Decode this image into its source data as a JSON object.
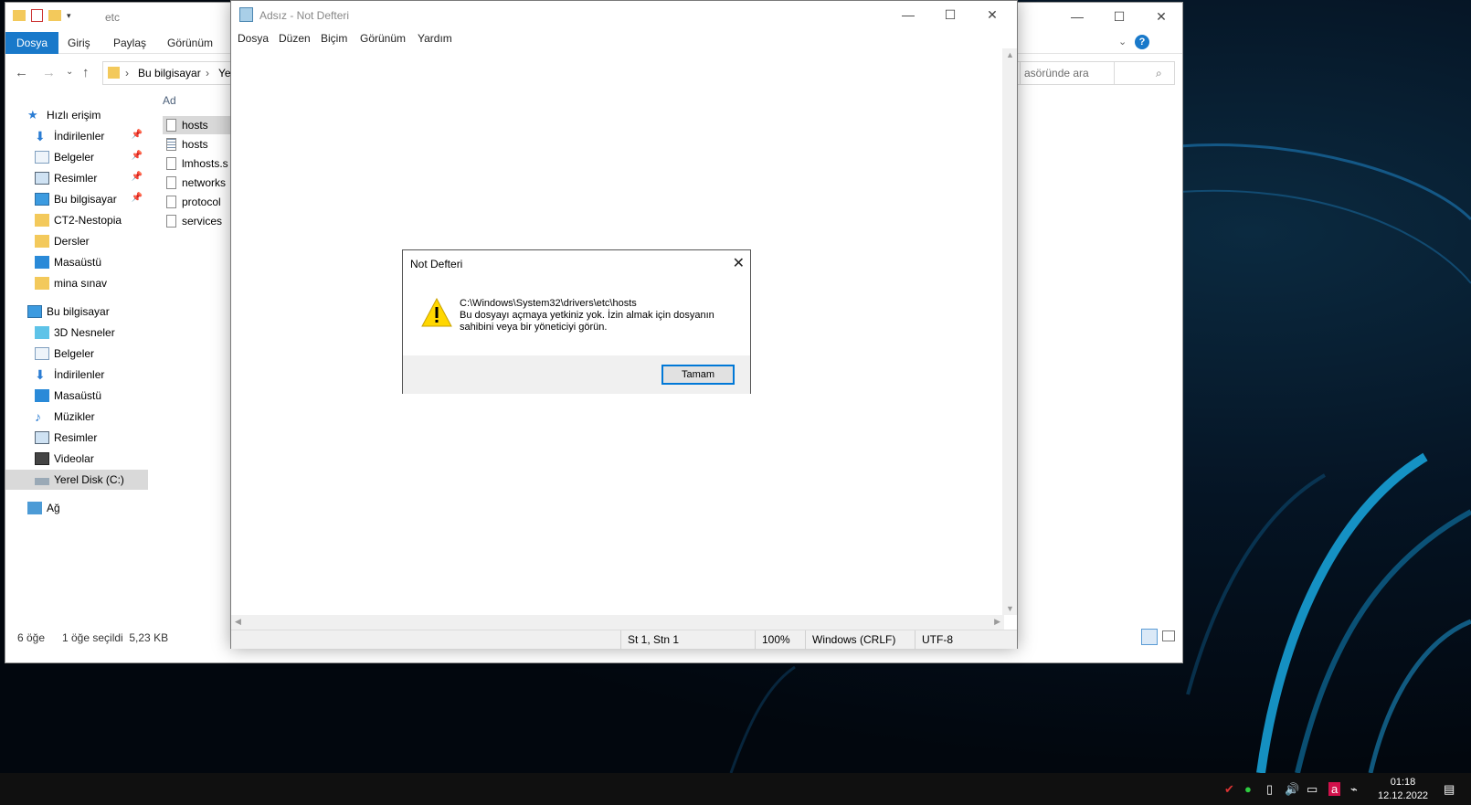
{
  "explorer": {
    "title": "etc",
    "ribbon_tabs": [
      "Dosya",
      "Giriş",
      "Paylaş",
      "Görünüm"
    ],
    "address": {
      "seg1": "Bu bilgisayar",
      "seg2": "Ye"
    },
    "search_placeholder": "asöründe ara",
    "column_name": "Ad",
    "quick_access": "Hızlı erişim",
    "nav_items": [
      {
        "label": "İndirilenler",
        "pinned": true
      },
      {
        "label": "Belgeler",
        "pinned": true
      },
      {
        "label": "Resimler",
        "pinned": true
      },
      {
        "label": "Bu bilgisayar",
        "pinned": true
      },
      {
        "label": "CT2-Nestopia",
        "pinned": false
      },
      {
        "label": "Dersler",
        "pinned": false
      },
      {
        "label": "Masaüstü",
        "pinned": false
      },
      {
        "label": "mina sınav",
        "pinned": false
      }
    ],
    "this_pc": "Bu bilgisayar",
    "pc_items": [
      "3D Nesneler",
      "Belgeler",
      "İndirilenler",
      "Masaüstü",
      "Müzikler",
      "Resimler",
      "Videolar",
      "Yerel Disk (C:)"
    ],
    "network": "Ağ",
    "files": [
      "hosts",
      "hosts",
      "lmhosts.s",
      "networks",
      "protocol",
      "services"
    ],
    "status_count": "6 öğe",
    "status_selected": "1 öğe seçildi  5,23 KB"
  },
  "notepad": {
    "title": "Adsız - Not Defteri",
    "menu": [
      "Dosya",
      "Düzen",
      "Biçim",
      "Görünüm",
      "Yardım"
    ],
    "status": {
      "position": "St 1, Stn 1",
      "zoom": "100%",
      "line_ending": "Windows (CRLF)",
      "encoding": "UTF-8"
    }
  },
  "dialog": {
    "title": "Not Defteri",
    "path": "C:\\Windows\\System32\\drivers\\etc\\hosts",
    "message_line1": "Bu dosyayı açmaya yetkiniz yok. İzin almak için dosyanın",
    "message_line2": "sahibini veya bir yöneticiyi görün.",
    "ok_label": "Tamam"
  },
  "taskbar": {
    "time": "01:18",
    "date": "12.12.2022"
  },
  "colors": {
    "accent": "#1979ca",
    "focus": "#0078d7",
    "taskbar": "#101010"
  }
}
